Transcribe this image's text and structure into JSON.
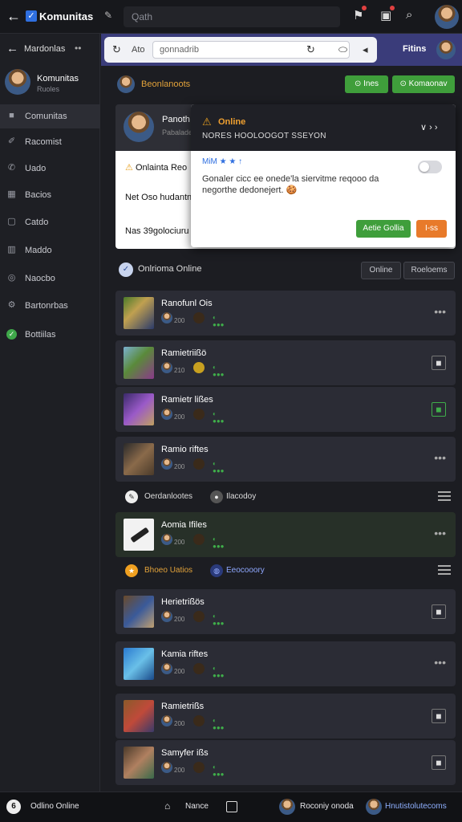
{
  "topbar": {
    "title": "Komunitas",
    "edit_icon": "pencil-icon",
    "search_placeholder": "Qath"
  },
  "sidebar": {
    "header_label": "Mardonlas",
    "user": {
      "name": "Komunitas",
      "sub": "Ruoles"
    },
    "items": [
      {
        "label": "Comunitas",
        "icon": "home-icon"
      },
      {
        "label": "Racomist",
        "icon": "pin-icon"
      },
      {
        "label": "Uado",
        "icon": "phone-icon"
      },
      {
        "label": "Bacios",
        "icon": "building-icon"
      },
      {
        "label": "Catdo",
        "icon": "image-icon"
      },
      {
        "label": "Maddo",
        "icon": "bag-icon"
      },
      {
        "label": "Naocbo",
        "icon": "target-icon"
      },
      {
        "label": "Bartonrbas",
        "icon": "gear-icon"
      },
      {
        "label": "Bottiilas",
        "icon": "check-icon"
      }
    ]
  },
  "address": {
    "ad_label": "Ato",
    "field_value": "gonnadrib",
    "right_label": "Fitins"
  },
  "section": {
    "title": "Beonlanoots",
    "btn1": "Ines",
    "btn2": "Komaonav"
  },
  "card": {
    "name": "Panoth",
    "sub": "Pabaladen",
    "row1": "Onlainta Reo",
    "row2": "Net Oso hudantn",
    "row3": "Nas 39golociuru"
  },
  "popup": {
    "title": "Online",
    "subtitle": "NORES HOOLOOGOT SSEYON",
    "meta": "MiM ★ ★ ↑",
    "body": "Gonaler cicc ee onede'la siervitme reqooo da negorthe dedonejert. 🍪",
    "btn_accept": "Aetie Gollia",
    "btn_other": "I-ss"
  },
  "filter": {
    "label": "Onlrioma Online",
    "pill1": "Online",
    "pill2": "Roeloems"
  },
  "items": [
    {
      "name": "Ranofunl Ois",
      "views": "200",
      "action": "more"
    },
    {
      "name": "Ramietriißö",
      "views": "210",
      "action": "box"
    },
    {
      "name": "Ramietr lißes",
      "views": "200",
      "action": "box-green"
    },
    {
      "name": "Ramio riftes",
      "views": "200",
      "action": "more"
    },
    {
      "name": "Aomia Ifiles",
      "views": "200",
      "action": "more"
    },
    {
      "name": "Herietrißös",
      "views": "200",
      "action": "box"
    },
    {
      "name": "Kamia riftes",
      "views": "200",
      "action": "more"
    },
    {
      "name": "Ramietrißs",
      "views": "200",
      "action": "box"
    },
    {
      "name": "Samyfer ißs",
      "views": "200",
      "action": "box"
    }
  ],
  "strips": {
    "s1_left": "Oerdanlootes",
    "s1_right": "Ilacodoy",
    "s2_left": "Bhoeo Uatios",
    "s2_right": "Eeocooory"
  },
  "bottom": {
    "left": "Odlino Online",
    "mid": "Nance",
    "right1": "Roconiy onoda",
    "right2": "Hnutistolutecoms"
  },
  "colors": {
    "accent_green": "#3f9e3b",
    "accent_orange": "#e87a2a",
    "header_purple": "#3a3c7a"
  }
}
